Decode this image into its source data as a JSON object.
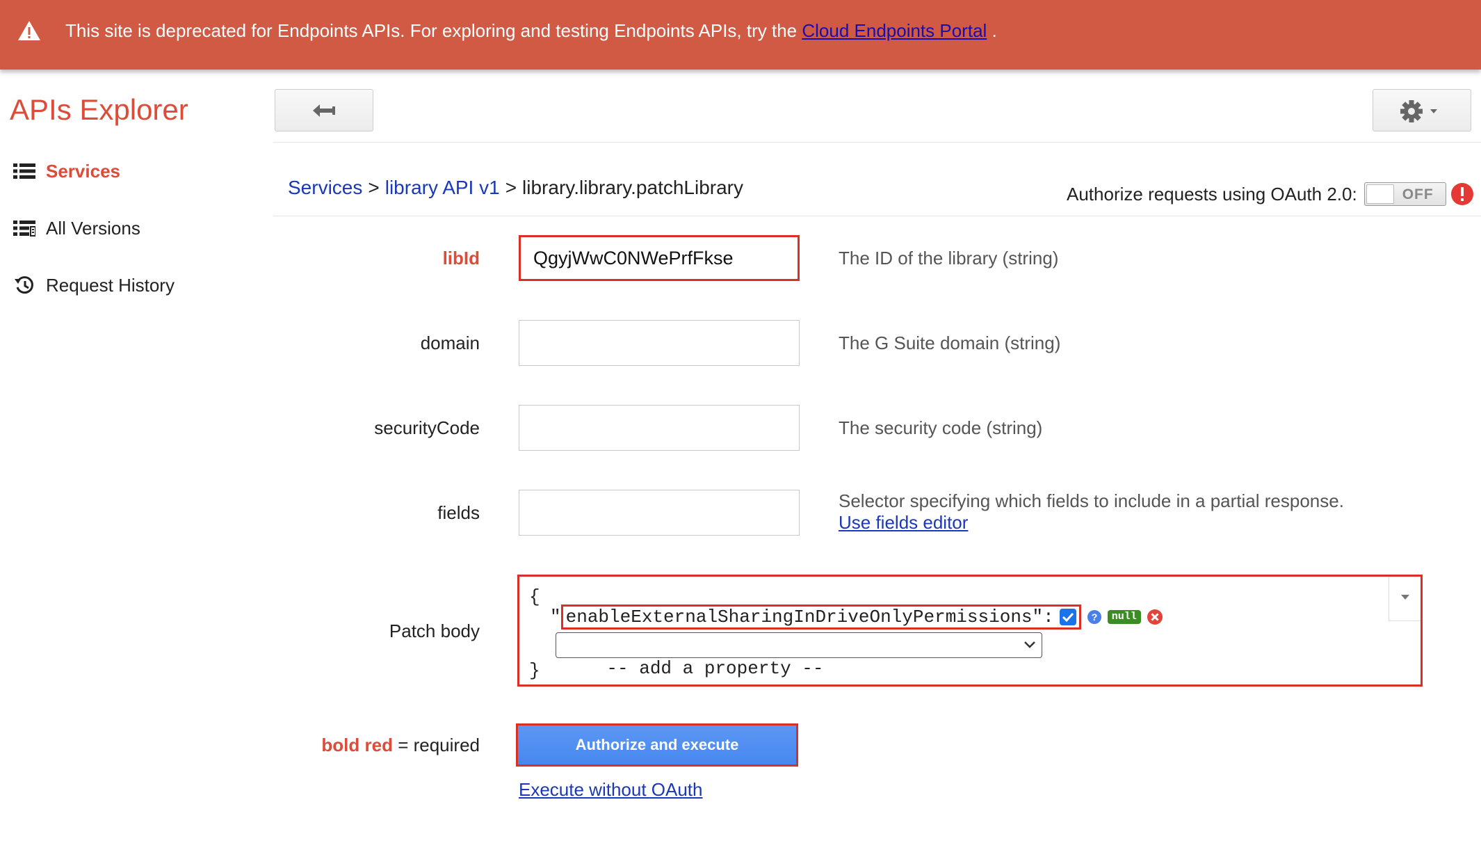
{
  "banner": {
    "text": "This site is deprecated for Endpoints APIs. For exploring and testing Endpoints APIs, try the ",
    "link_text": "Cloud Endpoints Portal",
    "suffix": " .",
    "icon": "warning-icon"
  },
  "header": {
    "app_title": "APIs Explorer",
    "back_icon": "back-arrow-icon",
    "settings_icon": "gear-icon"
  },
  "sidebar": {
    "items": [
      {
        "label": "Services",
        "icon": "list-icon",
        "active": true
      },
      {
        "label": "All Versions",
        "icon": "versions-list-icon",
        "active": false
      },
      {
        "label": "Request History",
        "icon": "history-icon",
        "active": false
      }
    ]
  },
  "breadcrumb": {
    "services": "Services",
    "api": "library API v1",
    "method": "library.library.patchLibrary",
    "separator": ">"
  },
  "oauth": {
    "label": "Authorize requests using OAuth 2.0:",
    "toggle_state": "OFF"
  },
  "form": {
    "fields": [
      {
        "label": "libId",
        "required": true,
        "value": "QgyjWwC0NWePrfFkse",
        "description": "The ID of the library (string)"
      },
      {
        "label": "domain",
        "required": false,
        "value": "",
        "description": "The G Suite domain (string)"
      },
      {
        "label": "securityCode",
        "required": false,
        "value": "",
        "description": "The security code (string)"
      },
      {
        "label": "fields",
        "required": false,
        "value": "",
        "description": "Selector specifying which fields to include in a partial response.",
        "link": "Use fields editor"
      }
    ],
    "patch_body": {
      "label": "Patch body",
      "open_brace": "{",
      "close_brace": "}",
      "quote_open": "\"",
      "property": "enableExternalSharingInDriveOnlyPermissions",
      "property_suffix": "\":",
      "checked": true,
      "null_label": "null",
      "add_property": "-- add a property --"
    }
  },
  "actions": {
    "required_note_bold": "bold red",
    "required_note_rest": " = required",
    "execute_button": "Authorize and execute",
    "execute_without": "Execute without OAuth"
  },
  "colors": {
    "banner": "#d05a44",
    "brand_red": "#dd4b39",
    "link_blue": "#1a38b8",
    "primary_button": "#4d8cf0",
    "highlight": "#d93025"
  }
}
